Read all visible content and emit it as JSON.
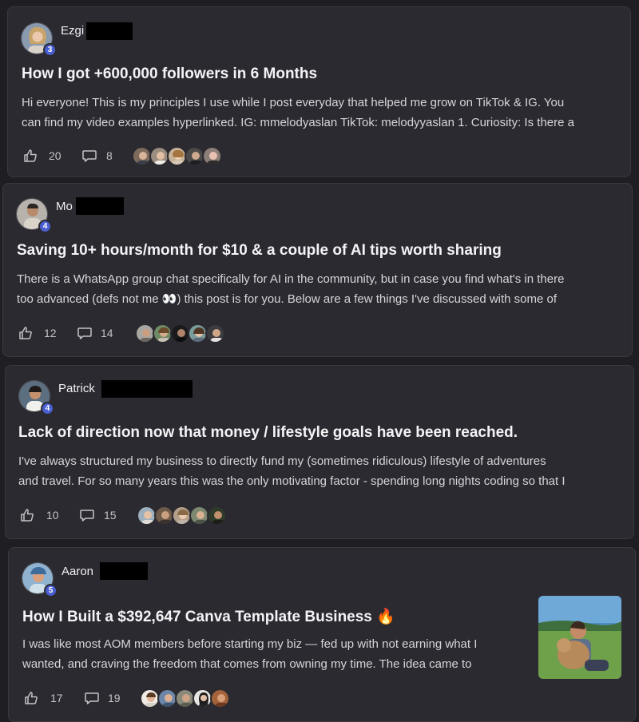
{
  "posts": [
    {
      "author": "Ezgi",
      "level": "3",
      "title": "How I got +600,000 followers in 6 Months",
      "excerpt_line1": "Hi everyone! This is my principles I use while I post everyday that helped me grow on TikTok & IG. You",
      "excerpt_line2": "can find my video examples hyperlinked. IG: mmelodyaslan TikTok: melodyyaslan 1. Curiosity: Is there a",
      "likes": "20",
      "comments": "8"
    },
    {
      "author": "Mo",
      "level": "4",
      "title": "Saving 10+ hours/month for $10 & a couple of AI tips worth sharing",
      "excerpt_line1": "There is a WhatsApp group chat specifically for AI in the community, but in case you find what's in there",
      "excerpt_line2": "too advanced (defs not me 👀) this post is for you. Below are a few things I've discussed with some of",
      "likes": "12",
      "comments": "14"
    },
    {
      "author": "Patrick",
      "level": "4",
      "title": "Lack of direction now that money / lifestyle goals have been reached.",
      "excerpt_line1": "I've always structured my business to directly fund my (sometimes ridiculous) lifestyle of adventures",
      "excerpt_line2": "and travel. For so many years this was the only motivating factor - spending long nights coding so that I",
      "likes": "10",
      "comments": "15"
    },
    {
      "author": "Aaron",
      "level": "5",
      "title": "How I Built a $392,647 Canva Template Business 🔥",
      "excerpt_line1": "I was like most AOM members before starting my biz — fed up with not earning what I",
      "excerpt_line2": "wanted, and craving the freedom that comes from owning my time. The idea came to",
      "likes": "17",
      "comments": "19"
    }
  ],
  "icons": {
    "like": "thumbs-up-icon",
    "comment": "comment-bubble-icon"
  },
  "colors": {
    "background": "#1f1e23",
    "card": "#2b2a30",
    "level_badge": "#4a5fd1"
  }
}
